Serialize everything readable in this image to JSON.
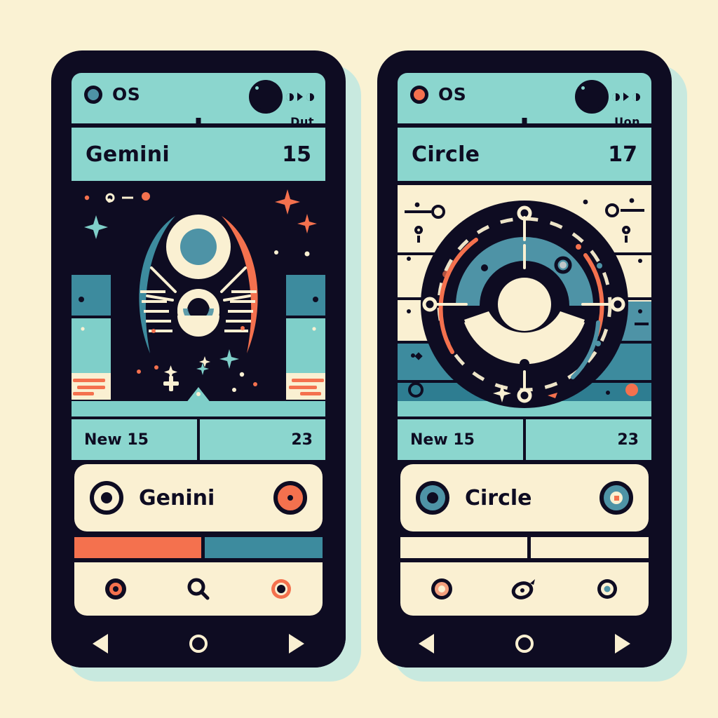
{
  "background_color": "#FAF2D3",
  "theme": {
    "dark": "#0E0C22",
    "teal": "#8BD6CE",
    "teal_deep": "#4E93A6",
    "teal_mid": "#3D8B9E",
    "orange": "#F4714E",
    "cream": "#FAF0D2"
  },
  "phones": [
    {
      "id": "left",
      "status_bar": {
        "os_label": "OS",
        "os_dot_color": "#4E93A6",
        "status_text": "Dut",
        "icons": [
          "signal-icon",
          "battery-icon",
          "chevron-right-icon",
          "info-icon"
        ]
      },
      "title_bar": {
        "title": "Gemini",
        "value": "15"
      },
      "hero": {
        "art_name": "gemini-cosmic-illustration"
      },
      "info_row": {
        "left": "New 15",
        "right": "23"
      },
      "app_card": {
        "name": "Genini",
        "leading_icon": "target-ring-icon",
        "trailing_icon": "orange-record-icon"
      },
      "progress": [
        {
          "name": "progress-segment-orange",
          "color": "#F4714E",
          "width_pct": 52
        },
        {
          "name": "progress-segment-teal",
          "color": "#3D8B9E",
          "width_pct": 48
        }
      ],
      "nav_items": [
        {
          "name": "nav-record-icon",
          "icon": "record-icon"
        },
        {
          "name": "nav-search-icon",
          "icon": "search-icon"
        },
        {
          "name": "nav-target-icon",
          "icon": "target-icon"
        }
      ],
      "system_bar": [
        "back-triangle-icon",
        "home-circle-icon",
        "forward-triangle-icon"
      ]
    },
    {
      "id": "right",
      "status_bar": {
        "os_label": "OS",
        "os_dot_color": "#F4714E",
        "status_text": "Uon",
        "icons": [
          "signal-icon",
          "battery-icon",
          "chevron-right-icon",
          "info-icon"
        ]
      },
      "title_bar": {
        "title": "Circle",
        "value": "17"
      },
      "hero": {
        "art_name": "circular-dial-illustration"
      },
      "info_row": {
        "left": "New 15",
        "right": "23"
      },
      "app_card": {
        "name": "Circle",
        "leading_icon": "teal-target-ring-icon",
        "trailing_icon": "teal-record-icon"
      },
      "progress": [
        {
          "name": "progress-segment-empty-left",
          "color": "#FAF0D2",
          "width_pct": 52
        },
        {
          "name": "progress-segment-empty-right",
          "color": "#FAF0D2",
          "width_pct": 48
        }
      ],
      "nav_items": [
        {
          "name": "nav-orange-record-icon",
          "icon": "record-icon"
        },
        {
          "name": "nav-comet-icon",
          "icon": "comet-icon"
        },
        {
          "name": "nav-blue-record-icon",
          "icon": "record-icon"
        }
      ],
      "system_bar": [
        "back-triangle-icon",
        "home-circle-icon",
        "forward-triangle-icon"
      ]
    }
  ]
}
